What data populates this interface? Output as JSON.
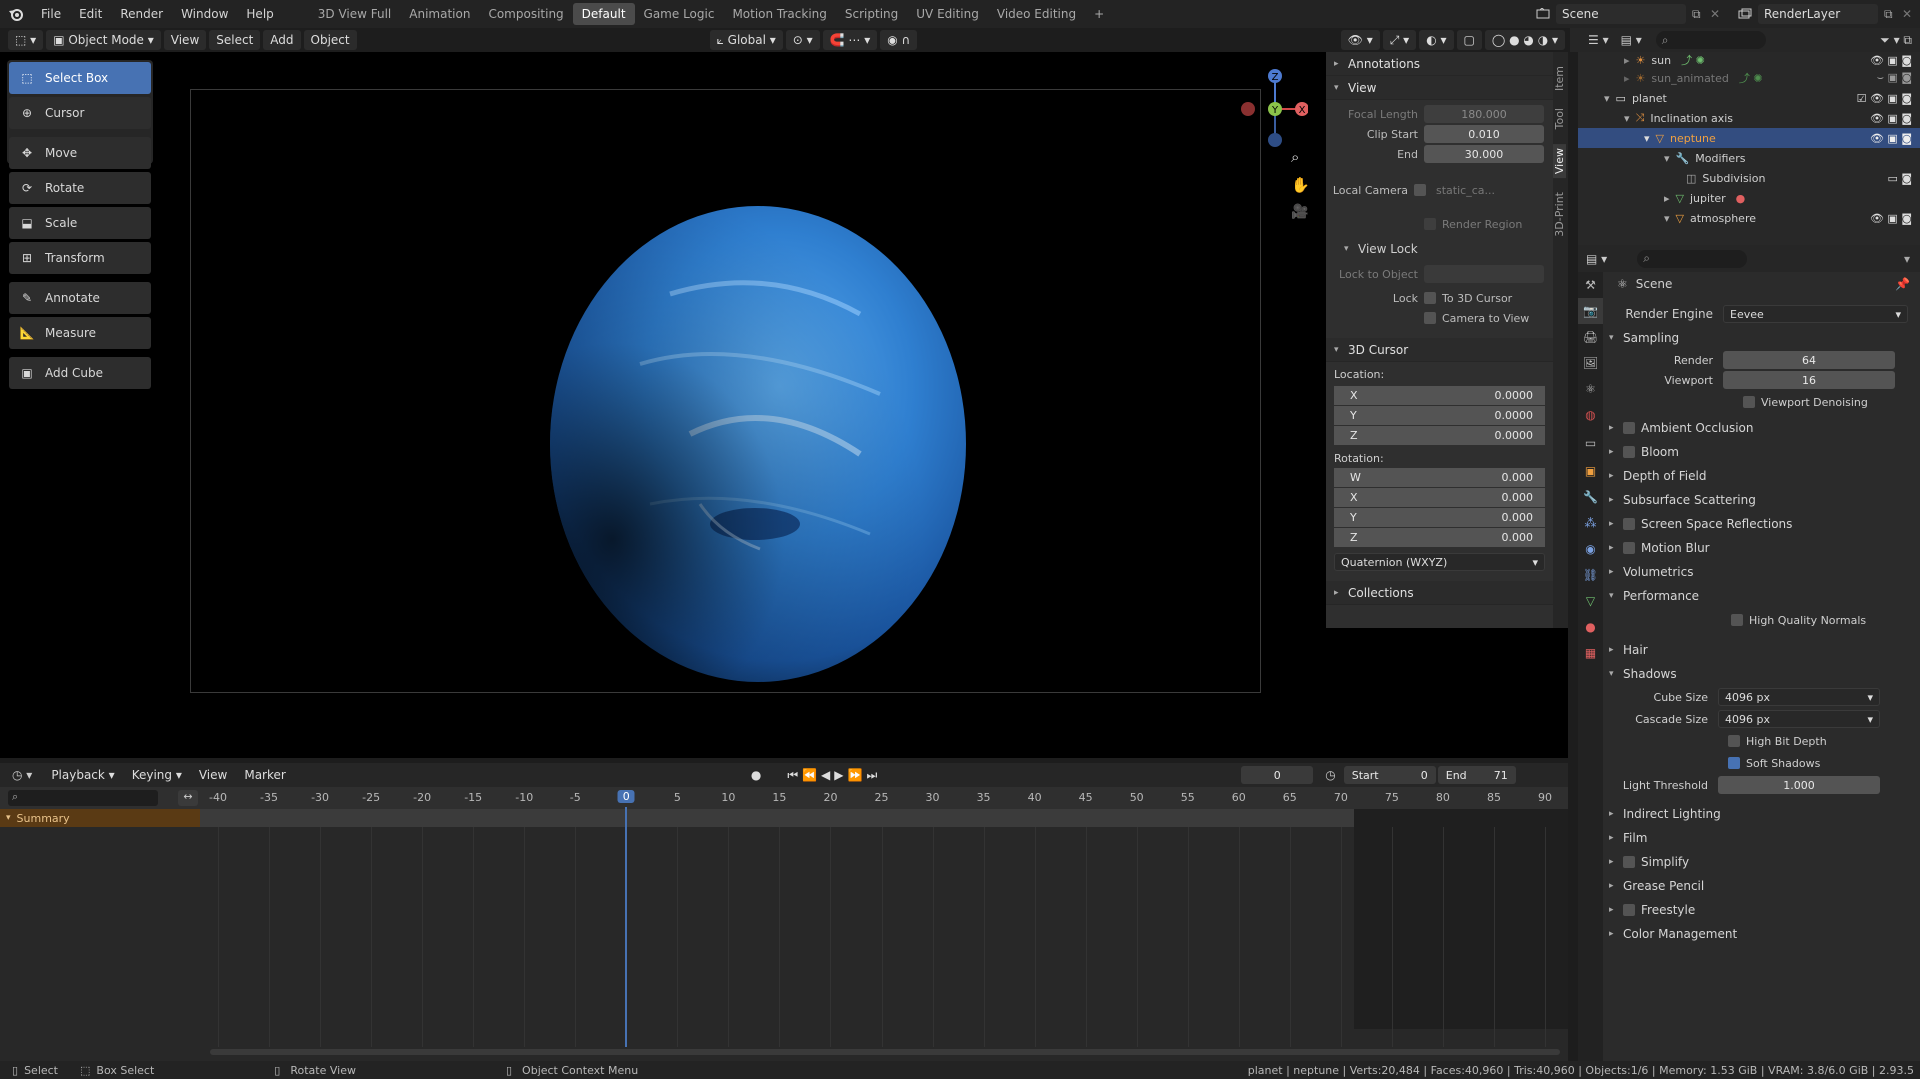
{
  "topbar": {
    "menus": [
      "File",
      "Edit",
      "Render",
      "Window",
      "Help"
    ],
    "workspaces": [
      "3D View Full",
      "Animation",
      "Compositing",
      "Default",
      "Game Logic",
      "Motion Tracking",
      "Scripting",
      "UV Editing",
      "Video Editing"
    ],
    "active_workspace": "Default",
    "scene": "Scene",
    "view_layer": "RenderLayer"
  },
  "viewport_header": {
    "mode": "Object Mode",
    "menus": [
      "View",
      "Select",
      "Add",
      "Object"
    ],
    "orientation": "Global"
  },
  "toolbar": {
    "tools": [
      "Select Box",
      "Cursor",
      "Move",
      "Rotate",
      "Scale",
      "Transform",
      "Annotate",
      "Measure",
      "Add Cube"
    ],
    "active": "Select Box"
  },
  "gizmo": {
    "x": "X",
    "y": "Y",
    "z": "Z"
  },
  "npanel": {
    "tabs": [
      "Item",
      "Tool",
      "View",
      "3D-Print"
    ],
    "annotations": "Annotations",
    "view": "View",
    "focal_length_label": "Focal Length",
    "focal_length": "180.000",
    "clip_start_label": "Clip Start",
    "clip_start": "0.010",
    "end_label": "End",
    "end": "30.000",
    "local_camera_label": "Local Camera",
    "local_camera_value": "static_ca...",
    "render_region": "Render Region",
    "view_lock": "View Lock",
    "lock_to_object": "Lock to Object",
    "lock_label": "Lock",
    "to_3d_cursor": "To 3D Cursor",
    "camera_to_view": "Camera to View",
    "cursor_section": "3D Cursor",
    "location_label": "Location:",
    "loc": [
      {
        "axis": "X",
        "value": "0.0000"
      },
      {
        "axis": "Y",
        "value": "0.0000"
      },
      {
        "axis": "Z",
        "value": "0.0000"
      }
    ],
    "rotation_label": "Rotation:",
    "rot": [
      {
        "axis": "W",
        "value": "0.000"
      },
      {
        "axis": "X",
        "value": "0.000"
      },
      {
        "axis": "Y",
        "value": "0.000"
      },
      {
        "axis": "Z",
        "value": "0.000"
      }
    ],
    "rotation_mode": "Quaternion (WXYZ)",
    "collections": "Collections"
  },
  "outliner": {
    "rows": [
      "sun",
      "sun_animated",
      "planet",
      "Inclination axis",
      "neptune",
      "Modifiers",
      "Subdivision",
      "jupiter",
      "atmosphere"
    ],
    "selected": "neptune"
  },
  "properties": {
    "context": "Scene",
    "render_engine_label": "Render Engine",
    "render_engine": "Eevee",
    "sampling": "Sampling",
    "render_label": "Render",
    "render_samples": "64",
    "viewport_label": "Viewport",
    "viewport_samples": "16",
    "viewport_denoising": "Viewport Denoising",
    "sections_a": [
      "Ambient Occlusion",
      "Bloom",
      "Depth of Field",
      "Subsurface Scattering",
      "Screen Space Reflections",
      "Motion Blur",
      "Volumetrics"
    ],
    "performance": "Performance",
    "high_quality_normals": "High Quality Normals",
    "hair": "Hair",
    "shadows": "Shadows",
    "cube_size_label": "Cube Size",
    "cube_size": "4096 px",
    "cascade_size_label": "Cascade Size",
    "cascade_size": "4096 px",
    "high_bit_depth": "High Bit Depth",
    "soft_shadows": "Soft Shadows",
    "light_threshold_label": "Light Threshold",
    "light_threshold": "1.000",
    "sections_b": [
      "Indirect Lighting",
      "Film",
      "Simplify",
      "Grease Pencil",
      "Freestyle",
      "Color Management"
    ]
  },
  "timeline": {
    "menus": [
      "Playback",
      "Keying",
      "View",
      "Marker"
    ],
    "current_frame": "0",
    "start_label": "Start",
    "start": "0",
    "end_label": "End",
    "end": "71",
    "ticks": [
      "-40",
      "-35",
      "-30",
      "-25",
      "-20",
      "-15",
      "-10",
      "-5",
      "0",
      "5",
      "10",
      "15",
      "20",
      "25",
      "30",
      "35",
      "40",
      "45",
      "50",
      "55",
      "60",
      "65",
      "70",
      "75",
      "80",
      "85",
      "90"
    ],
    "summary": "Summary"
  },
  "statusbar": {
    "select": "Select",
    "box_select": "Box Select",
    "rotate_view": "Rotate View",
    "context_menu": "Object Context Menu",
    "stats": "planet | neptune | Verts:20,484 | Faces:40,960 | Tris:40,960 | Objects:1/6 | Memory: 1.53 GiB | VRAM: 3.8/6.0 GiB | 2.93.5"
  },
  "colors": {
    "accent": "#4772b3",
    "planet": "#2f7fd0",
    "selected_row": "#334d80"
  }
}
